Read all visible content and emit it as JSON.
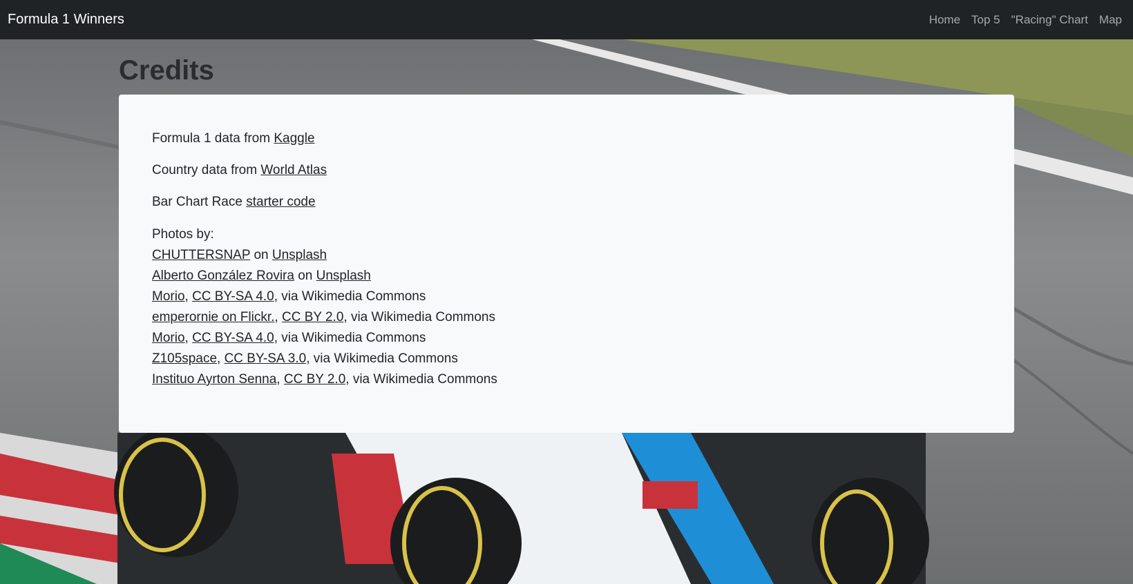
{
  "navbar": {
    "brand": "Formula 1 Winners",
    "links": [
      "Home",
      "Top 5",
      "\"Racing\" Chart",
      "Map"
    ]
  },
  "page": {
    "title": "Credits"
  },
  "credits": {
    "f1_prefix": "Formula 1 data from ",
    "f1_link": "Kaggle",
    "country_prefix": "Country data from ",
    "country_link": "World Atlas",
    "race_prefix": "Bar Chart Race ",
    "race_link": "starter code",
    "photos_heading": "Photos by:",
    "photos": [
      {
        "a": "CHUTTERSNAP",
        "sep": " on ",
        "b": "Unsplash",
        "suffix": ""
      },
      {
        "a": "Alberto González Rovira",
        "sep": " on ",
        "b": "Unsplash",
        "suffix": ""
      },
      {
        "a": "Morio",
        "sep": ", ",
        "b": "CC BY-SA 4.0",
        "suffix": ", via Wikimedia Commons"
      },
      {
        "a": "emperornie on Flickr.",
        "sep": ", ",
        "b": "CC BY 2.0",
        "suffix": ", via Wikimedia Commons"
      },
      {
        "a": "Morio",
        "sep": ", ",
        "b": "CC BY-SA 4.0",
        "suffix": ", via Wikimedia Commons"
      },
      {
        "a": "Z105space",
        "sep": ", ",
        "b": "CC BY-SA 3.0",
        "suffix": ", via Wikimedia Commons"
      },
      {
        "a": "Instituo Ayrton Senna",
        "sep": ", ",
        "b": "CC BY 2.0",
        "suffix": ", via Wikimedia Commons"
      }
    ]
  },
  "colors": {
    "navbar_bg": "#1f2326",
    "card_bg": "#f8f9fa",
    "text": "#212529"
  }
}
